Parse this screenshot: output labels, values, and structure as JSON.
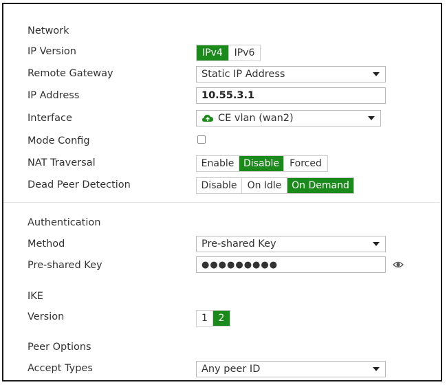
{
  "network": {
    "heading": "Network",
    "ip_version": {
      "label": "IP Version",
      "options": [
        "IPv4",
        "IPv6"
      ],
      "selected": "IPv4"
    },
    "remote_gateway": {
      "label": "Remote Gateway",
      "value": "Static IP Address"
    },
    "ip_address": {
      "label": "IP Address",
      "value": "10.55.3.1"
    },
    "interface": {
      "label": "Interface",
      "value": "CE vlan (wan2)",
      "icon": "cloud-icon"
    },
    "mode_config": {
      "label": "Mode Config",
      "checked": false
    },
    "nat_traversal": {
      "label": "NAT Traversal",
      "options": [
        "Enable",
        "Disable",
        "Forced"
      ],
      "selected": "Disable"
    },
    "dead_peer_detection": {
      "label": "Dead Peer Detection",
      "options": [
        "Disable",
        "On Idle",
        "On Demand"
      ],
      "selected": "On Demand"
    }
  },
  "authentication": {
    "heading": "Authentication",
    "method": {
      "label": "Method",
      "value": "Pre-shared Key"
    },
    "preshared_key": {
      "label": "Pre-shared Key",
      "value": "●●●●●●●●●",
      "icon": "eye-icon"
    }
  },
  "ike": {
    "heading": "IKE",
    "version": {
      "label": "Version",
      "options": [
        "1",
        "2"
      ],
      "selected": "2"
    }
  },
  "peer_options": {
    "heading": "Peer Options",
    "accept_types": {
      "label": "Accept Types",
      "value": "Any peer ID"
    }
  },
  "colors": {
    "accent": "#1a8a1a",
    "border": "#cfcfcf",
    "text": "#333333"
  }
}
